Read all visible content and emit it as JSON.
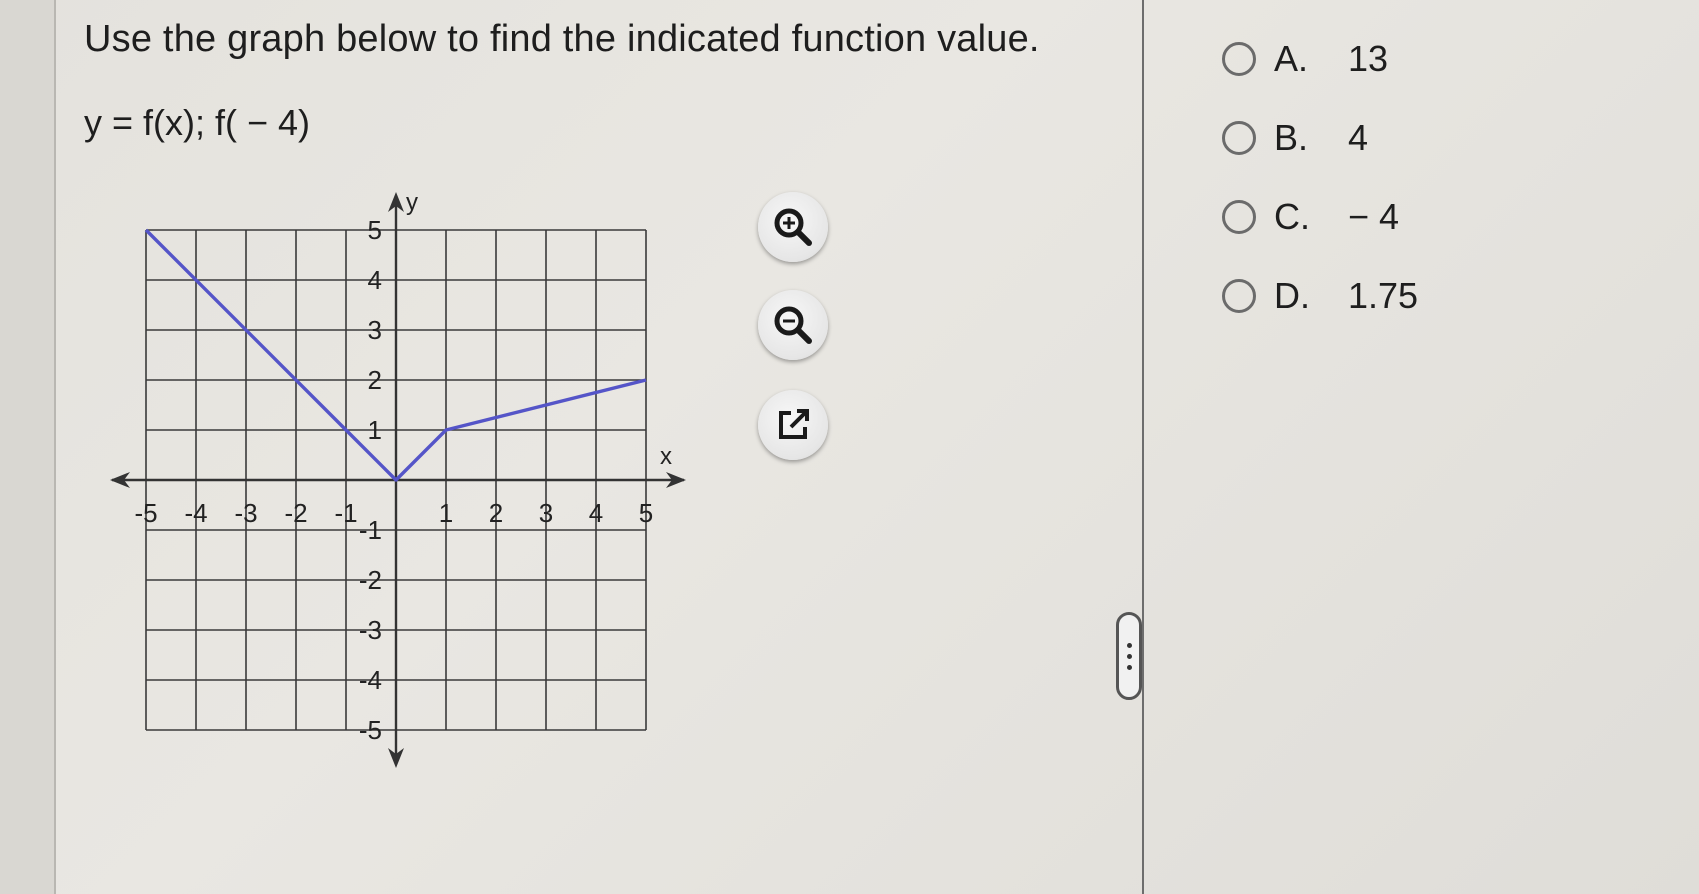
{
  "question": {
    "text": "Use the graph below to find the indicated function value."
  },
  "function_label": "y = f(x); f( − 4)",
  "tools": {
    "zoom_in_icon": "zoom-in-icon",
    "zoom_out_icon": "zoom-out-icon",
    "open_new_icon": "external-link-icon"
  },
  "answers": [
    {
      "letter": "A.",
      "value": "13"
    },
    {
      "letter": "B.",
      "value": "4"
    },
    {
      "letter": "C.",
      "value": "− 4"
    },
    {
      "letter": "D.",
      "value": "1.75"
    }
  ],
  "colors": {
    "line": "#5555c8",
    "grid": "#3a3a3a",
    "text": "#1e1e1e"
  },
  "chart_data": {
    "type": "line",
    "xlabel": "x",
    "ylabel": "y",
    "xlim": [
      -5,
      5
    ],
    "ylim": [
      -5,
      5
    ],
    "grid": true,
    "x_ticks": [
      "-5",
      "-4",
      "-3",
      "-2",
      "-1",
      "1",
      "2",
      "3",
      "4",
      "5"
    ],
    "y_ticks": [
      "5",
      "4",
      "3",
      "2",
      "1",
      "-1",
      "-2",
      "-3",
      "-4",
      "-5"
    ],
    "series": [
      {
        "x": [
          -5,
          -1,
          0,
          1,
          5
        ],
        "y": [
          5,
          1,
          0,
          1,
          2
        ]
      }
    ]
  }
}
